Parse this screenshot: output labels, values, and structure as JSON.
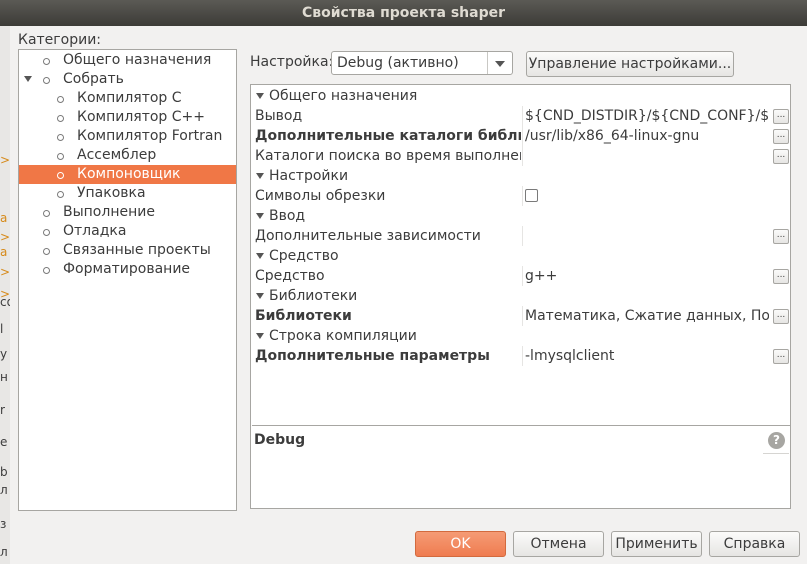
{
  "window": {
    "title": "Свойства проекта shaper"
  },
  "left_strip": {
    "fragments": [
      ">",
      "a",
      ">",
      "a",
      ">",
      ">",
      "co",
      "l",
      "у",
      "н",
      "r",
      "e",
      "b",
      "л",
      "з",
      "л"
    ]
  },
  "categories": {
    "label": "Категории:",
    "items": [
      {
        "label": "Общего назначения",
        "level": 0,
        "expandable": false
      },
      {
        "label": "Собрать",
        "level": 0,
        "expandable": true
      },
      {
        "label": "Компилятор C",
        "level": 1
      },
      {
        "label": "Компилятор C++",
        "level": 1
      },
      {
        "label": "Компилятор Fortran",
        "level": 1
      },
      {
        "label": "Ассемблер",
        "level": 1
      },
      {
        "label": "Компоновщик",
        "level": 1,
        "selected": true
      },
      {
        "label": "Упаковка",
        "level": 1
      },
      {
        "label": "Выполнение",
        "level": 0
      },
      {
        "label": "Отладка",
        "level": 0
      },
      {
        "label": "Связанные проекты",
        "level": 0
      },
      {
        "label": "Форматирование",
        "level": 0
      }
    ]
  },
  "config": {
    "label": "Настройка:",
    "selected": "Debug (активно)",
    "manage_label": "Управление настройками..."
  },
  "properties": [
    {
      "type": "category",
      "name": "Общего назначения"
    },
    {
      "type": "prop",
      "name": "Вывод",
      "value": "${CND_DISTDIR}/${CND_CONF}/${...",
      "bold": false,
      "dots": true
    },
    {
      "type": "prop",
      "name": "Дополнительные каталоги библиот",
      "value": "/usr/lib/x86_64-linux-gnu",
      "bold": true,
      "dots": true
    },
    {
      "type": "prop",
      "name": "Каталоги поиска во время выполнен",
      "value": "",
      "bold": false,
      "dots": true
    },
    {
      "type": "category",
      "name": "Настройки"
    },
    {
      "type": "checkbox",
      "name": "Символы обрезки",
      "checked": false
    },
    {
      "type": "category",
      "name": "Ввод"
    },
    {
      "type": "prop",
      "name": "Дополнительные зависимости",
      "value": "",
      "bold": false,
      "dots": true
    },
    {
      "type": "category",
      "name": "Средство"
    },
    {
      "type": "prop",
      "name": "Средство",
      "value": "g++",
      "bold": false,
      "dots": true
    },
    {
      "type": "category",
      "name": "Библиотеки"
    },
    {
      "type": "prop",
      "name": "Библиотеки",
      "value": "Математика, Сжатие данных, По...",
      "bold": true,
      "dots": true
    },
    {
      "type": "category",
      "name": "Строка компиляции"
    },
    {
      "type": "prop",
      "name": "Дополнительные параметры",
      "value": "-lmysqlclient",
      "bold": true,
      "dots": true
    }
  ],
  "description": {
    "title": "Debug",
    "help_icon": "?"
  },
  "buttons": {
    "ok": "OK",
    "cancel": "Отмена",
    "apply": "Применить",
    "help": "Справка"
  },
  "colors": {
    "accent": "#f07746",
    "titlebar": "#3c3b37"
  }
}
